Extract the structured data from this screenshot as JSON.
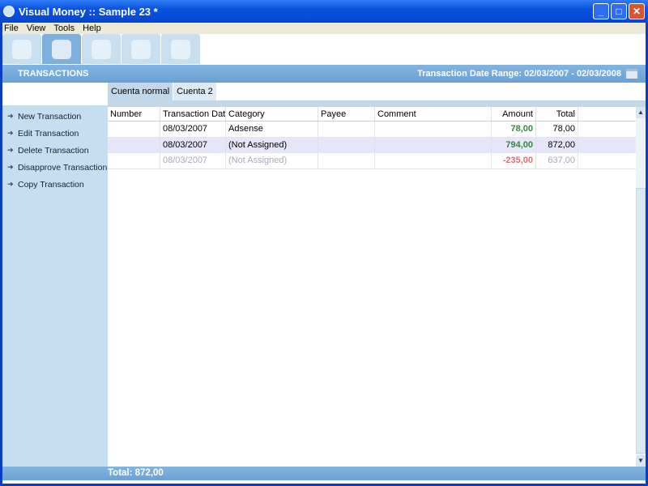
{
  "window": {
    "title": "Visual Money :: Sample 23 *",
    "minimize": "_",
    "maximize": "□",
    "close": "✕"
  },
  "menu": [
    "File",
    "View",
    "Tools",
    "Help"
  ],
  "toolbar": [
    {
      "icon": "contacts-icon"
    },
    {
      "icon": "transactions-icon",
      "active": true
    },
    {
      "icon": "accounts-icon"
    },
    {
      "icon": "users-icon"
    },
    {
      "icon": "reports-icon"
    }
  ],
  "header": {
    "title": "TRANSACTIONS",
    "date_range": "Transaction Date Range: 02/03/2007 - 02/03/2008"
  },
  "sidebar": {
    "items": [
      "New Transaction",
      "Edit Transaction",
      "Delete Transaction",
      "Disapprove Transaction",
      "Copy Transaction"
    ]
  },
  "tabs": [
    "Cuenta normal",
    "Cuenta 2"
  ],
  "table": {
    "columns": [
      "Number",
      "Transaction Date",
      "Category",
      "Payee",
      "Comment",
      "Amount",
      "Total"
    ],
    "rows": [
      {
        "number": "",
        "date": "08/03/2007",
        "category": "Adsense",
        "payee": "",
        "comment": "",
        "amount": "78,00",
        "total": "78,00"
      },
      {
        "number": "",
        "date": "08/03/2007",
        "category": "(Not Assigned)",
        "payee": "",
        "comment": "",
        "amount": "794,00",
        "total": "872,00"
      },
      {
        "number": "",
        "date": "08/03/2007",
        "category": "(Not Assigned)",
        "payee": "",
        "comment": "",
        "amount": "-235,00",
        "total": "637,00"
      }
    ]
  },
  "footer": {
    "total": "Total: 872,00"
  },
  "colors": {
    "positive": "#2e8a3e",
    "negative": "#e07070",
    "header": "#6aa1d3",
    "sidebar": "#c5dff0"
  }
}
